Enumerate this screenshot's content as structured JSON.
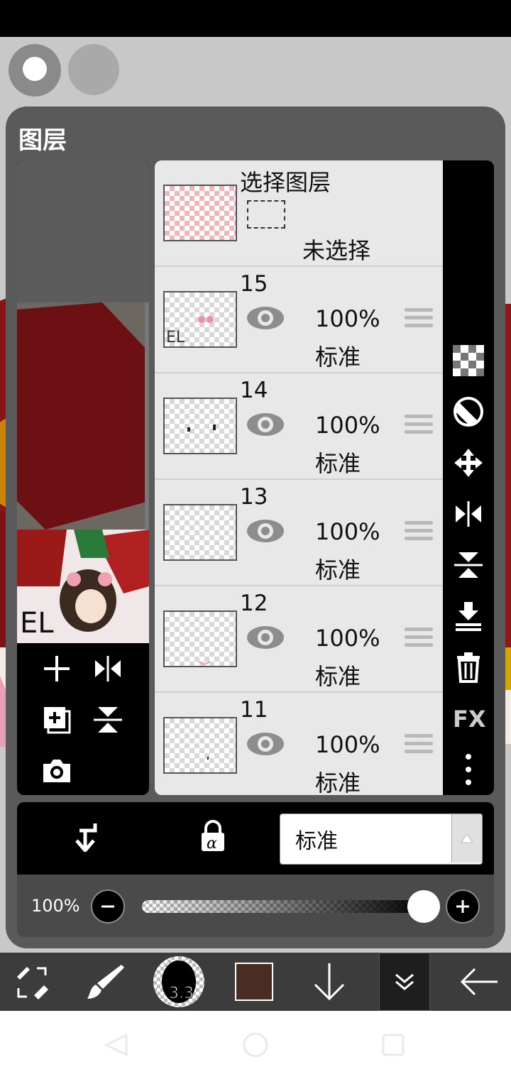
{
  "panel": {
    "title": "图层"
  },
  "selection_layer": {
    "title": "选择图层",
    "status": "未选择"
  },
  "layers": [
    {
      "number": "15",
      "opacity": "100%",
      "blend": "标准"
    },
    {
      "number": "14",
      "opacity": "100%",
      "blend": "标准"
    },
    {
      "number": "13",
      "opacity": "100%",
      "blend": "标准"
    },
    {
      "number": "12",
      "opacity": "100%",
      "blend": "标准"
    },
    {
      "number": "11",
      "opacity": "100%",
      "blend": "标准"
    }
  ],
  "blend_mode": {
    "selected": "标准"
  },
  "opacity_control": {
    "label": "100%",
    "value": 1.0
  },
  "toolbar": {
    "brush_size": "3.3",
    "current_color": "#4a2d22"
  },
  "colors": {
    "panel_bg": "#5a5a5a",
    "list_bg": "#e8e8e8",
    "selection_checker": "#f0b5b8"
  },
  "icons": {
    "left_tools": [
      "add-layer-icon",
      "flip-horizontal-icon",
      "duplicate-layer-icon",
      "flip-vertical-icon",
      "camera-icon"
    ],
    "right_tools": [
      "transparency-checker-icon",
      "clear-icon",
      "move-icon",
      "flip-horizontal-icon",
      "flip-vertical-icon",
      "merge-down-icon",
      "trash-icon",
      "fx-icon",
      "more-icon"
    ]
  }
}
